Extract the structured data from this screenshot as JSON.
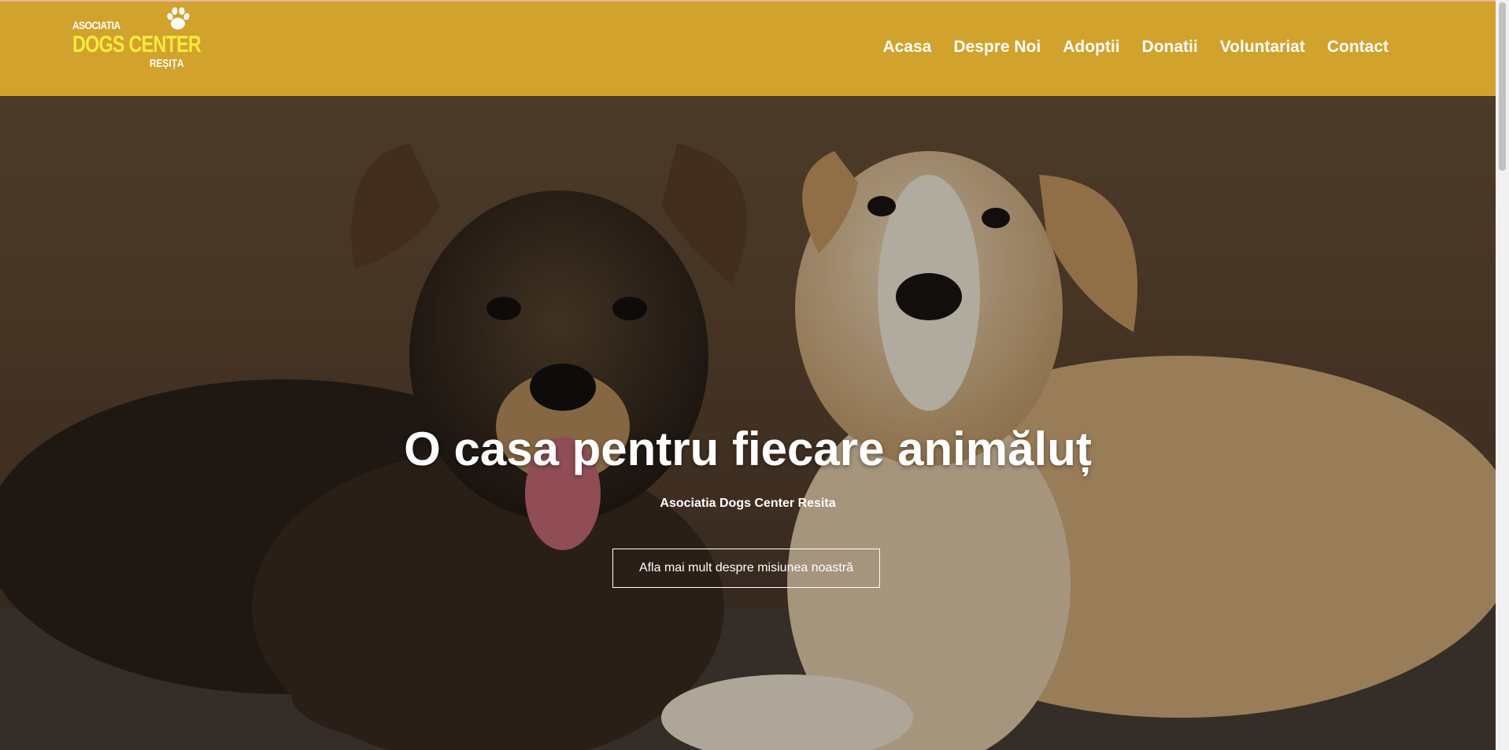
{
  "logo": {
    "line1": "ASOCIATIA",
    "line2": "DOGS CENTER",
    "line3": "REȘIȚA",
    "icon": "paw-icon"
  },
  "nav": {
    "items": [
      "Acasa",
      "Despre Noi",
      "Adoptii",
      "Donatii",
      "Voluntariat",
      "Contact"
    ]
  },
  "hero": {
    "title": "O casa pentru fiecare animăluț",
    "subtitle": "Asociatia Dogs Center Resita",
    "button_label": "Afla mai mult despre misiunea noastră",
    "image": "two-puppies-photo"
  },
  "colors": {
    "header_bg": "#d1a22c",
    "logo_accent": "#f5ea3c",
    "text": "#ffffff"
  }
}
